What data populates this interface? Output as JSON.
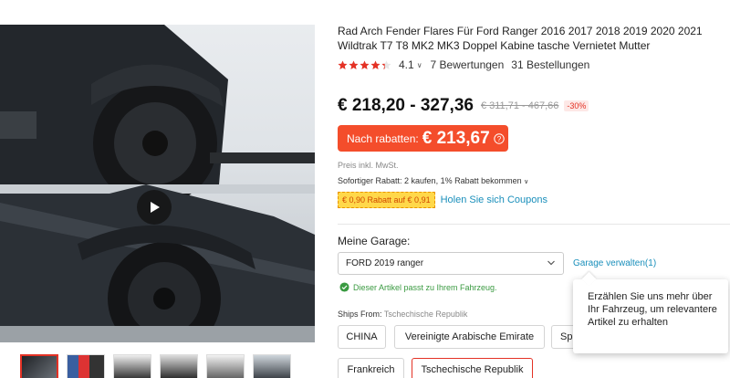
{
  "product": {
    "title": "Rad Arch Fender Flares Für Ford Ranger 2016 2017 2018 2019 2020 2021 Wildtrak T7 T8 MK2 MK3 Doppel Kabine tasche Vernietet Mutter",
    "rating": "4.1",
    "rating_fraction": 0.82,
    "reviews": "7 Bewertungen",
    "orders": "31 Bestellungen"
  },
  "pricing": {
    "price_range": "€ 218,20 - 327,36",
    "old_price": "€ 311,71 - 467,66",
    "discount": "-30%",
    "promo_label": "Nach rabatten:",
    "promo_price": "€ 213,67",
    "tax_note": "Preis inkl. MwSt.",
    "instant_discount": "Sofortiger Rabatt: 2 kaufen, 1% Rabatt bekommen",
    "coupon_tag": "€ 0,90 Rabatt auf € 0,91",
    "coupon_link": "Holen Sie sich Coupons"
  },
  "garage": {
    "label": "Meine Garage:",
    "selected_vehicle": "FORD 2019 ranger",
    "manage_link": "Garage verwalten(1)",
    "fit_message": "Dieser Artikel passt zu Ihrem Fahrzeug.",
    "tooltip": "Erzählen Sie uns mehr über Ihr Fahrzeug, um relevantere Artikel zu erhalten"
  },
  "shipping": {
    "label": "Ships From:",
    "value": "Tschechische Republik",
    "options": [
      "CHINA",
      "Vereinigte Arabische Emirate",
      "Spanien",
      "Frankreich",
      "Tschechische Republik"
    ],
    "selected": "Tschechische Republik"
  },
  "icons": {
    "star": "star-icon",
    "play": "play-icon",
    "info": "info-icon",
    "check": "check-circle-icon",
    "chevron": "chevron-down-icon"
  },
  "colors": {
    "accent": "#e43225",
    "promo": "#f44d2b",
    "link": "#1a8fbb",
    "success": "#3a9a41",
    "coupon": "#ffd84a"
  }
}
